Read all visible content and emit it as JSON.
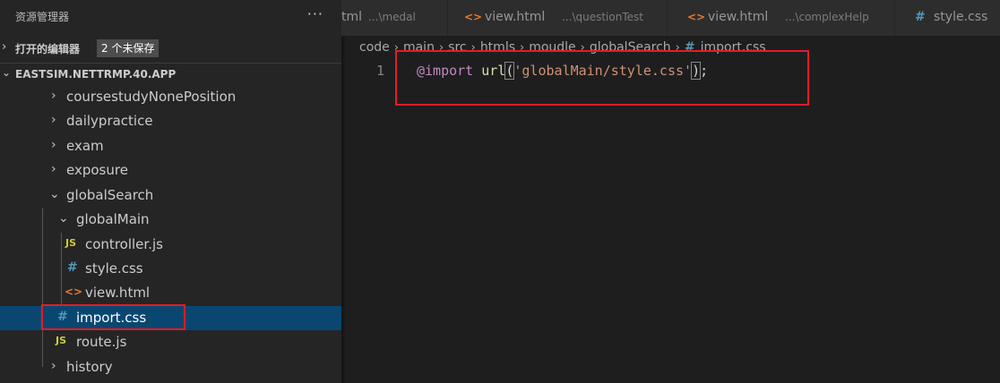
{
  "sidebar": {
    "title": "资源管理器",
    "more_icon": "ellipsis-icon",
    "open_editors": {
      "label": "打开的编辑器",
      "badge": "2 个未保存"
    },
    "project": {
      "label": "EASTSIM.NETTRMP.40.APP"
    },
    "tree": [
      {
        "name": "coursestudyNonePosition",
        "kind": "folder",
        "expanded": false
      },
      {
        "name": "dailypractice",
        "kind": "folder",
        "expanded": false
      },
      {
        "name": "exam",
        "kind": "folder",
        "expanded": false
      },
      {
        "name": "exposure",
        "kind": "folder",
        "expanded": false
      },
      {
        "name": "globalSearch",
        "kind": "folder",
        "expanded": true
      },
      {
        "name": "globalMain",
        "kind": "folder",
        "expanded": true
      },
      {
        "name": "controller.js",
        "kind": "js",
        "icon_text": "JS"
      },
      {
        "name": "style.css",
        "kind": "css",
        "icon_text": "#"
      },
      {
        "name": "view.html",
        "kind": "html",
        "icon_text": "<>"
      },
      {
        "name": "import.css",
        "kind": "css",
        "icon_text": "#",
        "selected": true
      },
      {
        "name": "route.js",
        "kind": "js",
        "icon_text": "JS"
      },
      {
        "name": "history",
        "kind": "folder",
        "expanded": false
      }
    ]
  },
  "tabs": [
    {
      "name": "tml",
      "path": "...\\medal",
      "icon_text": ""
    },
    {
      "name": "view.html",
      "path": "...\\questionTest",
      "icon_text": "<>"
    },
    {
      "name": "view.html",
      "path": "...\\complexHelp",
      "icon_text": "<>"
    },
    {
      "name": "style.css",
      "path": "",
      "icon_text": "#"
    }
  ],
  "breadcrumb": {
    "parts": [
      "code",
      "main",
      "src",
      "htmls",
      "moudle",
      "globalSearch"
    ],
    "file_icon": "#",
    "file": "import.css"
  },
  "editor": {
    "line_number": "1",
    "code": {
      "at_rule": "@import",
      "fn": "url",
      "open": "(",
      "string": "'globalMain/style.css'",
      "close": ")",
      "end": ";"
    }
  },
  "colors": {
    "accent_selection": "#094771",
    "highlight_box": "#e51c23",
    "js_icon": "#cbcb41",
    "css_icon": "#519aba",
    "html_icon": "#e37933"
  }
}
